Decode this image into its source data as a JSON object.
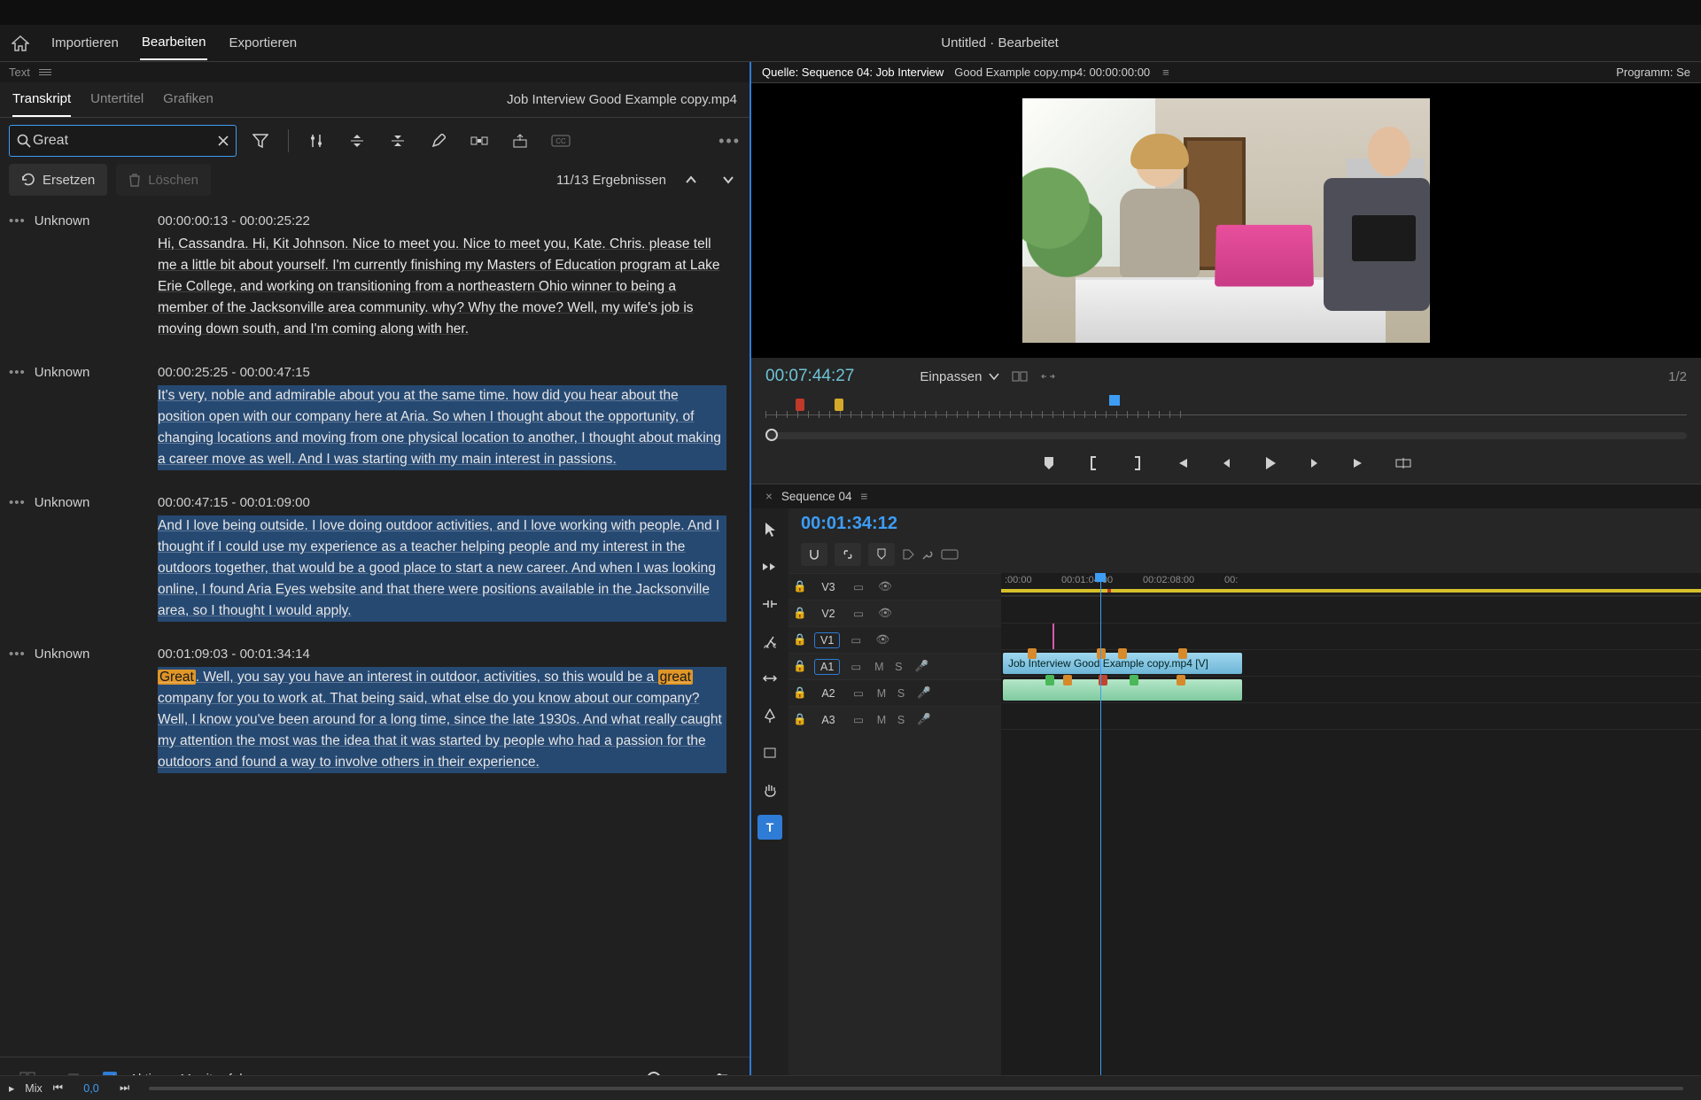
{
  "topbar": {
    "tabs": [
      "Importieren",
      "Bearbeiten",
      "Exportieren"
    ],
    "active_tab": 1,
    "doc_title": "Untitled · Bearbeitet"
  },
  "text_panel": {
    "label": "Text",
    "tabs": [
      "Transkript",
      "Untertitel",
      "Grafiken"
    ],
    "active_tab": 0,
    "filename": "Job Interview Good Example copy.mp4",
    "search": {
      "value": "Great",
      "placeholder": ""
    },
    "replace_label": "Ersetzen",
    "delete_label": "Löschen",
    "results_label": "11/13 Ergebnissen",
    "follow_active_label": "Aktivem Monitor folgen"
  },
  "segments": [
    {
      "speaker": "Unknown",
      "time": "00:00:00:13 - 00:00:25:22",
      "selected": false,
      "text": "Hi, Cassandra. Hi, Kit Johnson. Nice to meet you. Nice to meet you, Kate. Chris. please tell me a little bit about yourself. I'm currently finishing my Masters of Education program at Lake Erie College, and working on transitioning from a northeastern Ohio winner to being a member of the Jacksonville area community. why? Why the move? Well, my wife's job is moving down south, and I'm coming along with her."
    },
    {
      "speaker": "Unknown",
      "time": "00:00:25:25 - 00:00:47:15",
      "selected": true,
      "text": "It's very, noble and admirable about you at the same time. how did you hear about the position open with our company here at Aria. So when I thought about the opportunity, of changing locations and moving from one physical location to another, I thought about making a career move as well. And I was starting with my main interest in passions."
    },
    {
      "speaker": "Unknown",
      "time": "00:00:47:15 - 00:01:09:00",
      "selected": true,
      "text": "And I love being outside. I love doing outdoor activities, and I love working with people. And I thought if I could use my experience as a teacher helping people and my interest in the outdoors together, that would be a good place to start a new career. And when I was looking online, I found Aria Eyes website and that there were positions available in the Jacksonville area, so I thought I would apply."
    },
    {
      "speaker": "Unknown",
      "time": "00:01:09:03 - 00:01:34:14",
      "selected": true,
      "hits": [
        "Great",
        "great"
      ],
      "text": "Great. Well, you say you have an interest in outdoor, activities, so this would be a great company for you to work at. That being said, what else do you know about our company? Well, I know you've been around for a long time, since the late 1930s. And what really caught my attention the most was the idea that it was started by people who had a passion for the outdoors and found a way to involve others in their experience."
    }
  ],
  "source_panel": {
    "source_tab": "Quelle: Sequence 04: Job Interview",
    "clip_info": "Good Example copy.mp4: 00:00:00:00",
    "program_tab": "Programm: Se",
    "big_tc": "00:07:44:27",
    "fit_label": "Einpassen",
    "ratio": "1/2"
  },
  "timeline": {
    "seq_name": "Sequence 04",
    "tc": "00:01:34:12",
    "time_labels": [
      ":00:00",
      "00:01:04:00",
      "00:02:08:00",
      "00:"
    ],
    "tracks_v": [
      "V3",
      "V2",
      "V1"
    ],
    "tracks_a": [
      "A1",
      "A2",
      "A3"
    ],
    "clip_label": "Job Interview   Good Example copy.mp4 [V]",
    "mix_label": "Mix",
    "mix_value": "0,0"
  }
}
